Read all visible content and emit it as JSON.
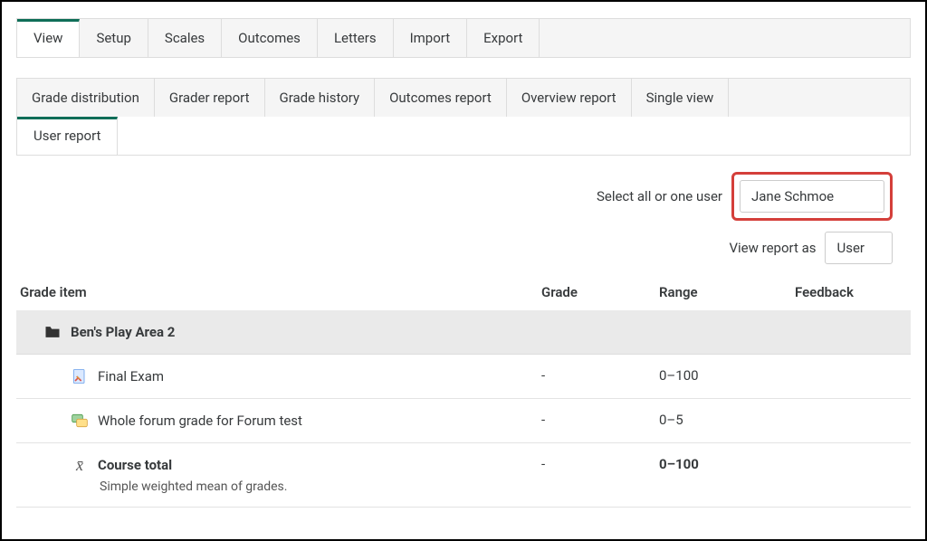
{
  "primary_tabs": {
    "items": [
      "View",
      "Setup",
      "Scales",
      "Outcomes",
      "Letters",
      "Import",
      "Export"
    ],
    "active": "View"
  },
  "secondary_tabs": {
    "row1": [
      "Grade distribution",
      "Grader report",
      "Grade history",
      "Outcomes report",
      "Overview report",
      "Single view"
    ],
    "row2": [
      "User report"
    ],
    "active": "User report"
  },
  "selectors": {
    "user_label": "Select all or one user",
    "user_value": "Jane Schmoe",
    "view_label": "View report as",
    "view_value": "User"
  },
  "table": {
    "headers": {
      "item": "Grade item",
      "grade": "Grade",
      "range": "Range",
      "feedback": "Feedback"
    },
    "category": "Ben's Play Area 2",
    "rows": [
      {
        "name": "Final Exam",
        "grade": "-",
        "range": "0–100",
        "icon": "assignment",
        "bold": false
      },
      {
        "name": "Whole forum grade for Forum test",
        "grade": "-",
        "range": "0–5",
        "icon": "forum",
        "bold": false
      },
      {
        "name": "Course total",
        "grade": "-",
        "range": "0–100",
        "icon": "xbar",
        "bold": true,
        "desc": "Simple weighted mean of grades."
      }
    ]
  }
}
